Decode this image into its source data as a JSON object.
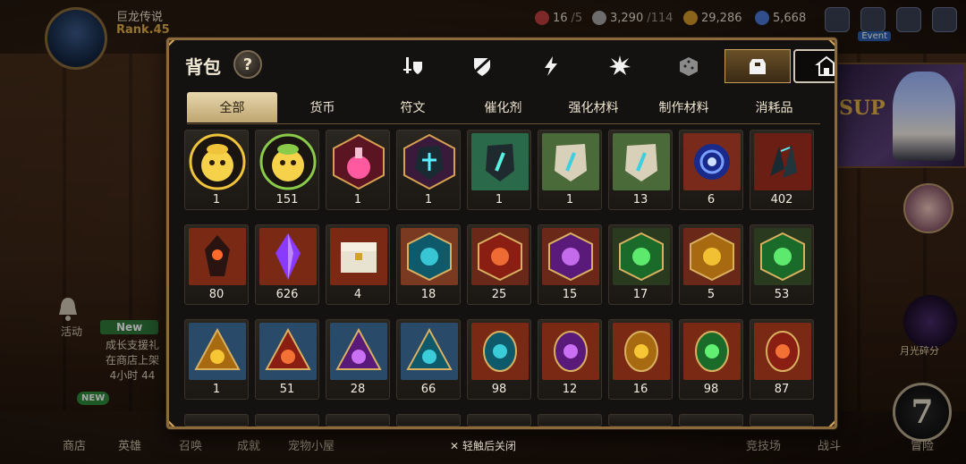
{
  "hud": {
    "player_name": "巨龙传说",
    "player_rank": "Rank.45",
    "resources": [
      {
        "value": "16",
        "max": "/5",
        "icon": "stamina-icon",
        "color": "#c04040"
      },
      {
        "value": "3,290",
        "max": "/114",
        "icon": "silver-coin-icon",
        "color": "#a8a8a8"
      },
      {
        "value": "29,286",
        "max": "",
        "icon": "gold-coin-icon",
        "color": "#d69a2a"
      },
      {
        "value": "5,668",
        "max": "",
        "icon": "gem-icon",
        "color": "#4a7ad8"
      }
    ],
    "event_label": "Event",
    "left_activity_label": "活动",
    "new_badge": "New",
    "growth_text_line1": "成长支援礼",
    "growth_text_line2": "在商店上架",
    "growth_text_line3": "4小时 44",
    "new_small": "NEW",
    "banner_text": "SUP",
    "right_rune_label": "月光碎分",
    "adventure_number": "7",
    "bottom_nav": [
      "商店",
      "英雄",
      "召唤",
      "成就",
      "宠物小屋",
      "竞技场",
      "战斗",
      "冒险"
    ]
  },
  "panel": {
    "title": "背包",
    "help": "?",
    "filters": [
      {
        "icon": "weapon-armor-icon",
        "selected": false
      },
      {
        "icon": "broken-shield-icon",
        "selected": false
      },
      {
        "icon": "lightning-icon",
        "selected": false
      },
      {
        "icon": "burst-icon",
        "selected": false
      },
      {
        "icon": "dice-icon",
        "selected": false
      },
      {
        "icon": "bag-icon",
        "selected": true
      },
      {
        "icon": "house-icon",
        "selected": false
      }
    ],
    "tabs": [
      "全部",
      "货币",
      "符文",
      "催化剂",
      "强化材料",
      "制作材料",
      "消耗品"
    ],
    "active_tab": "全部",
    "items": [
      {
        "qty": "1",
        "kind": "hamster-gold"
      },
      {
        "qty": "151",
        "kind": "hamster-green"
      },
      {
        "qty": "1",
        "kind": "potion"
      },
      {
        "qty": "1",
        "kind": "dark-crystal"
      },
      {
        "qty": "1",
        "kind": "green-rune-stone"
      },
      {
        "qty": "1",
        "kind": "beige-rune-stone"
      },
      {
        "qty": "13",
        "kind": "beige-rune-stone-b"
      },
      {
        "qty": "6",
        "kind": "blue-swirl-orb"
      },
      {
        "qty": "402",
        "kind": "dark-shards"
      },
      {
        "qty": "80",
        "kind": "red-dark-gem"
      },
      {
        "qty": "626",
        "kind": "purple-crystal"
      },
      {
        "qty": "4",
        "kind": "treasure-chest"
      },
      {
        "qty": "18",
        "kind": "hex-cyan"
      },
      {
        "qty": "25",
        "kind": "hex-red"
      },
      {
        "qty": "15",
        "kind": "hex-purple"
      },
      {
        "qty": "17",
        "kind": "hex-green"
      },
      {
        "qty": "5",
        "kind": "hex-gold"
      },
      {
        "qty": "53",
        "kind": "hex-green-b"
      },
      {
        "qty": "1",
        "kind": "tri-gold"
      },
      {
        "qty": "51",
        "kind": "tri-red"
      },
      {
        "qty": "28",
        "kind": "tri-purple"
      },
      {
        "qty": "66",
        "kind": "tri-cyan"
      },
      {
        "qty": "98",
        "kind": "oval-cyan"
      },
      {
        "qty": "12",
        "kind": "oval-purple"
      },
      {
        "qty": "16",
        "kind": "oval-gold"
      },
      {
        "qty": "98",
        "kind": "oval-green"
      },
      {
        "qty": "87",
        "kind": "oval-red"
      }
    ]
  },
  "close_hint": "轻触后关闭",
  "colors": {
    "panel_border": "#8d6a3c",
    "tab_active_bg": "#d8c491",
    "accent_gold": "#e3b14a"
  }
}
